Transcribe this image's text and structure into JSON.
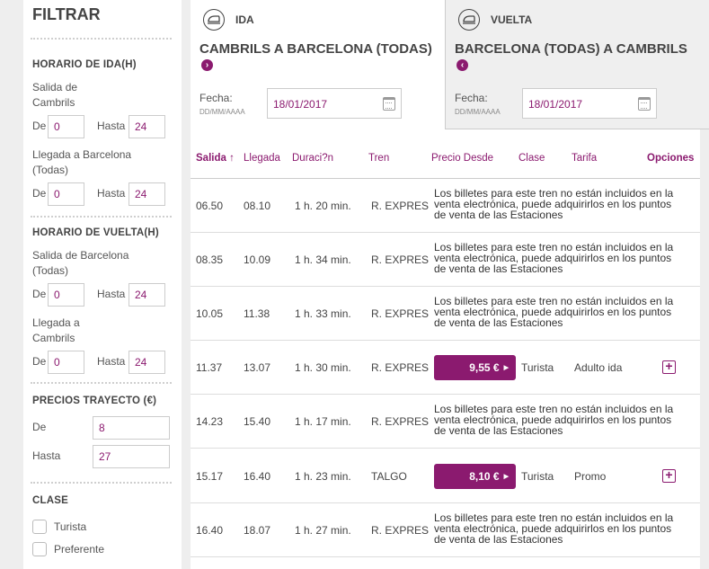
{
  "sidebar": {
    "title": "FILTRAR",
    "horario_ida": {
      "title": "HORARIO DE IDA(H)",
      "salida_label": "Salida de Cambrils",
      "llegada_label": "Llegada a Barcelona (Todas)",
      "de_label": "De",
      "hasta_label": "Hasta",
      "salida_de": "0",
      "salida_hasta": "24",
      "llegada_de": "0",
      "llegada_hasta": "24"
    },
    "horario_vuelta": {
      "title": "HORARIO DE VUELTA(H)",
      "salida_label": "Salida de Barcelona (Todas)",
      "llegada_label": "Llegada a Cambrils",
      "de_label": "De",
      "hasta_label": "Hasta",
      "salida_de": "0",
      "salida_hasta": "24",
      "llegada_de": "0",
      "llegada_hasta": "24"
    },
    "precios": {
      "title": "PRECIOS TRAYECTO (€)",
      "de_label": "De",
      "hasta_label": "Hasta",
      "de_value": "8",
      "hasta_value": "27"
    },
    "clase": {
      "title": "CLASE",
      "options": [
        "Turista",
        "Preferente"
      ]
    }
  },
  "tabs": {
    "ida": {
      "label": "IDA",
      "route": "CAMBRILS A BARCELONA (TODAS)",
      "fecha_label": "Fecha:",
      "fecha_format": "DD/MM/AAAA",
      "date": "18/01/2017"
    },
    "vuelta": {
      "label": "VUELTA",
      "route": "BARCELONA (TODAS) A CAMBRILS",
      "fecha_label": "Fecha:",
      "fecha_format": "DD/MM/AAAA",
      "date": "18/01/2017"
    }
  },
  "table": {
    "headers": {
      "salida": "Salida",
      "llegada": "Llegada",
      "duracion": "Duraci?n",
      "tren": "Tren",
      "precio": "Precio Desde",
      "clase": "Clase",
      "tarifa": "Tarifa",
      "opciones": "Opciones"
    },
    "sort_icon": "arrow-up-icon",
    "note": "Los billetes para este tren no están incluidos en la venta electrónica, puede adquirirlos en los puntos de venta de las Estaciones",
    "rows": [
      {
        "salida": "06.50",
        "llegada": "08.10",
        "duracion": "1 h. 20 min.",
        "tren": "R. EXPRES",
        "price": "",
        "clase": "",
        "tarifa": ""
      },
      {
        "salida": "08.35",
        "llegada": "10.09",
        "duracion": "1 h. 34 min.",
        "tren": "R. EXPRES",
        "price": "",
        "clase": "",
        "tarifa": ""
      },
      {
        "salida": "10.05",
        "llegada": "11.38",
        "duracion": "1 h. 33 min.",
        "tren": "R. EXPRES",
        "price": "",
        "clase": "",
        "tarifa": ""
      },
      {
        "salida": "11.37",
        "llegada": "13.07",
        "duracion": "1 h. 30 min.",
        "tren": "R. EXPRES",
        "price": "9,55 €",
        "clase": "Turista",
        "tarifa": "Adulto ida"
      },
      {
        "salida": "14.23",
        "llegada": "15.40",
        "duracion": "1 h. 17 min.",
        "tren": "R. EXPRES",
        "price": "",
        "clase": "",
        "tarifa": ""
      },
      {
        "salida": "15.17",
        "llegada": "16.40",
        "duracion": "1 h. 23 min.",
        "tren": "TALGO",
        "price": "8,10 €",
        "clase": "Turista",
        "tarifa": "Promo"
      },
      {
        "salida": "16.40",
        "llegada": "18.07",
        "duracion": "1 h. 27 min.",
        "tren": "R. EXPRES",
        "price": "",
        "clase": "",
        "tarifa": ""
      }
    ]
  },
  "colors": {
    "accent": "#8b1a6f",
    "background": "#eeeeee",
    "panel": "#ffffff"
  }
}
